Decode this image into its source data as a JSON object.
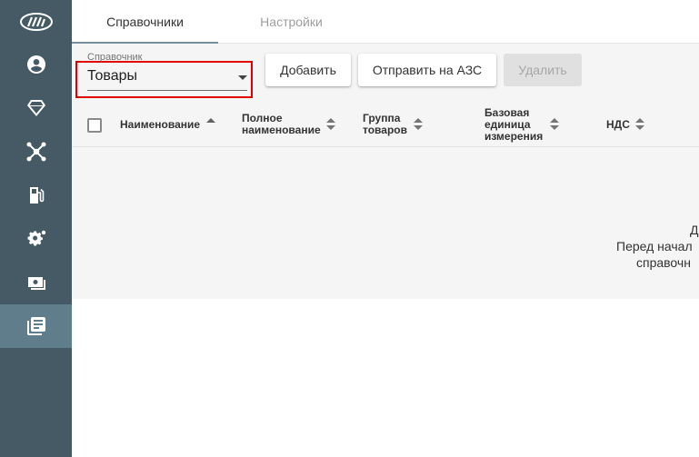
{
  "sidebar": {
    "items": [
      {
        "icon": "logo-icon",
        "active": false
      },
      {
        "icon": "account-icon",
        "active": false
      },
      {
        "icon": "diamond-icon",
        "active": false
      },
      {
        "icon": "network-icon",
        "active": false
      },
      {
        "icon": "fuel-pump-icon",
        "active": false
      },
      {
        "icon": "gear-icon",
        "active": false
      },
      {
        "icon": "cash-icon",
        "active": false
      },
      {
        "icon": "library-books-icon",
        "active": true
      }
    ],
    "colors": {
      "background": "#455a64",
      "active": "#607d8b"
    }
  },
  "tabs": [
    {
      "label": "Справочники",
      "active": true
    },
    {
      "label": "Настройки",
      "active": false
    }
  ],
  "toolbar": {
    "select_label": "Справочник",
    "select_value": "Товары",
    "add_label": "Добавить",
    "send_label": "Отправить на АЗС",
    "delete_label": "Удалить"
  },
  "table": {
    "columns": [
      {
        "line1": "Наименование",
        "line2": "",
        "line3": "",
        "sort": "asc"
      },
      {
        "line1": "Полное",
        "line2": "наименование",
        "line3": "",
        "sort": "none"
      },
      {
        "line1": "Группа",
        "line2": "товаров",
        "line3": "",
        "sort": "none"
      },
      {
        "line1": "Базовая",
        "line2": "единица",
        "line3": "измерения",
        "sort": "none"
      },
      {
        "line1": "НДС",
        "line2": "",
        "line3": "",
        "sort": "none"
      }
    ]
  },
  "empty_state": {
    "line1": "Д",
    "line2": "Перед начал",
    "line3": "справочн"
  },
  "colors": {
    "highlight": "#e00000",
    "tab_indicator": "#78909c"
  }
}
